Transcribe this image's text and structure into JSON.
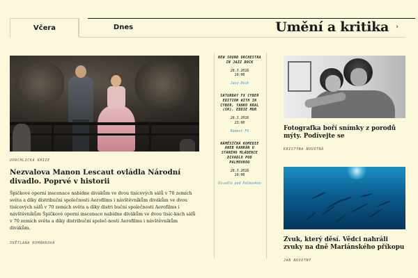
{
  "header": {
    "tabs": [
      {
        "label": "Včera",
        "active": true
      },
      {
        "label": "Dnes",
        "active": false
      }
    ],
    "section_title": "Umění a kritika",
    "chevron_icon": "chevron-right-icon"
  },
  "lead_article": {
    "kicker": "UPRCHLICKÁ KRIZE",
    "headline": "Nezvalova Manon Lescaut ovládla Národní divadlo. Poprvé v historii",
    "body": "Špičkové operní inscenace nabídne divákům ve dvou tisícových sálů v 70 zemích světa a díky distribuční společnosti Aerofilms i návštěvníkům divákům ve dvou tisícových sálů v 70 zemích světa a díky distri buční společnosti Aerofilms i návštěvníkům Špičkové operní inscenace nabídne divákům ve dvou tisíc-kách sálů v 70 zemích světa a díky distribuční společ-nosti Aerofilms i návštěvníkům divákům.",
    "byline": "SVĚTLANA KOMÁRKOVÁ"
  },
  "events": [
    {
      "title": "NEW SOUND ORCHESTRA IN JAZZ DOCK",
      "datetime": "26.3.2016\n19:00",
      "venue": "Jazz Dock"
    },
    {
      "title": "SATURDAY FX CYBER EDITION WITH IN CYBER, YANKO KRAL (SK), EDDIE MUR",
      "datetime": "26.3.2016\n23:00",
      "venue": "Rádost FX"
    },
    {
      "title": "NÁMĚSÍČNÁ KOMEDIE ANEB KANKÁN U STARÉHO MLÁDENCE DIVADLO POD PALMOVKOU",
      "datetime": "26.3.2016\n19:00",
      "venue": "Divadlo pod Palmovkou"
    }
  ],
  "stories": [
    {
      "headline": "Fotografka boří snímky z porodů mýty. Podívejte se",
      "byline": "KRISTÝNA NOVOTNÁ"
    },
    {
      "headline": "Zvuk, který děsí. Vědci nahráli zvuky na dně Mariánského příkopu",
      "byline": "JAN NOVOTNÝ"
    }
  ],
  "colors": {
    "background": "#fbf8dc",
    "text": "#1a1a1a",
    "link": "#4a90c8",
    "divider": "#d7d3b5"
  }
}
